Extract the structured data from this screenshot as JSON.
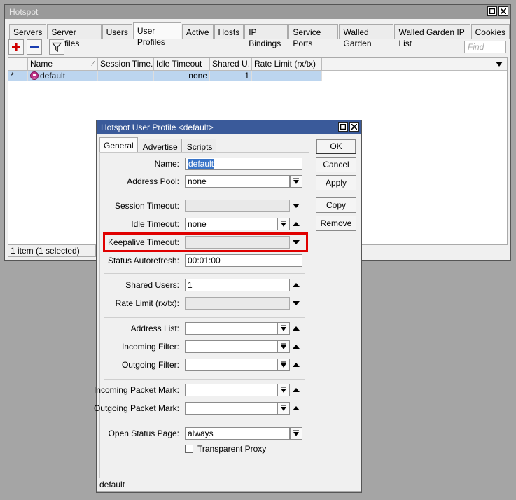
{
  "main": {
    "title": "Hotspot",
    "tabs": [
      "Servers",
      "Server Profiles",
      "Users",
      "User Profiles",
      "Active",
      "Hosts",
      "IP Bindings",
      "Service Ports",
      "Walled Garden",
      "Walled Garden IP List",
      "Cookies"
    ],
    "active_tab": "User Profiles",
    "find_placeholder": "Find",
    "columns": [
      "Name",
      "Session Time...",
      "Idle Timeout",
      "Shared U...",
      "Rate Limit (rx/tx)"
    ],
    "rows": [
      {
        "flag": "*",
        "name": "default",
        "session_timeout": "",
        "idle_timeout": "none",
        "shared_users": "1",
        "rate_limit": ""
      }
    ],
    "status": "1 item (1 selected)"
  },
  "dialog": {
    "title": "Hotspot User Profile <default>",
    "tabs": [
      "General",
      "Advertise",
      "Scripts"
    ],
    "active_tab": "General",
    "buttons": {
      "ok": "OK",
      "cancel": "Cancel",
      "apply": "Apply",
      "copy": "Copy",
      "remove": "Remove"
    },
    "fields": {
      "name": {
        "label": "Name:",
        "value": "default"
      },
      "address_pool": {
        "label": "Address Pool:",
        "value": "none"
      },
      "session_timeout": {
        "label": "Session Timeout:",
        "value": ""
      },
      "idle_timeout": {
        "label": "Idle Timeout:",
        "value": "none"
      },
      "keepalive_timeout": {
        "label": "Keepalive Timeout:",
        "value": ""
      },
      "status_autorefresh": {
        "label": "Status Autorefresh:",
        "value": "00:01:00"
      },
      "shared_users": {
        "label": "Shared Users:",
        "value": "1"
      },
      "rate_limit": {
        "label": "Rate Limit (rx/tx):",
        "value": ""
      },
      "address_list": {
        "label": "Address List:",
        "value": ""
      },
      "incoming_filter": {
        "label": "Incoming Filter:",
        "value": ""
      },
      "outgoing_filter": {
        "label": "Outgoing Filter:",
        "value": ""
      },
      "incoming_packet_mark": {
        "label": "Incoming Packet Mark:",
        "value": ""
      },
      "outgoing_packet_mark": {
        "label": "Outgoing Packet Mark:",
        "value": ""
      },
      "open_status_page": {
        "label": "Open Status Page:",
        "value": "always"
      },
      "transparent_proxy": {
        "label": "Transparent Proxy",
        "checked": false
      }
    },
    "status": "default",
    "highlight_color": "#e00000"
  }
}
